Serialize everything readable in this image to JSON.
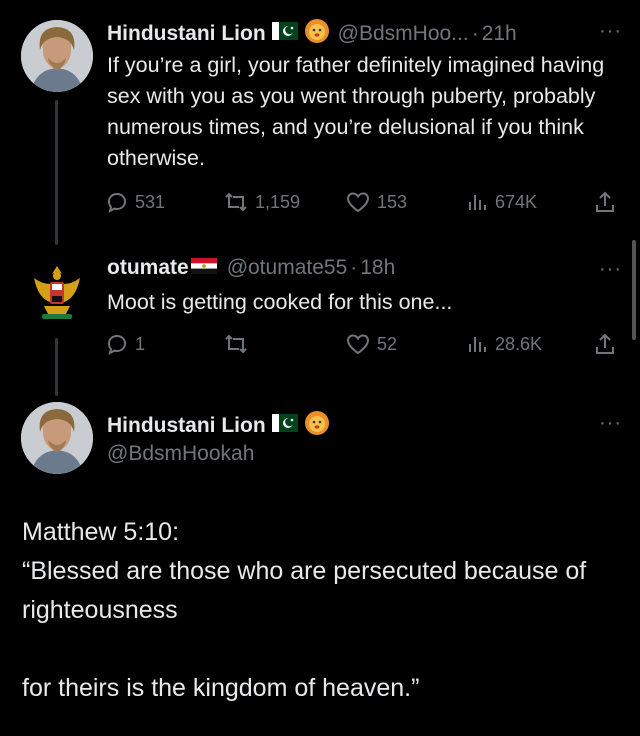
{
  "tweets": [
    {
      "name": "Hindustani Lion",
      "handle": "@BdsmHoo...",
      "time": "21h",
      "text": "If you’re a girl, your father definitely imagined having sex with you as you went through puberty, probably numerous times, and you’re delusional if you think otherwise.",
      "replies": "531",
      "reposts": "1,159",
      "likes": "153",
      "views": "674K"
    },
    {
      "name": "otumate",
      "handle": "@otumate55",
      "time": "18h",
      "text": "Moot is getting cooked for this one...",
      "replies": "1",
      "reposts": "",
      "likes": "52",
      "views": "28.6K"
    }
  ],
  "main_tweet": {
    "name": "Hindustani Lion",
    "handle": "@BdsmHookah",
    "text": "Matthew 5:10:\n“Blessed are those who are persecuted because of righteousness\n\nfor theirs is the kingdom of heaven.”"
  },
  "separator": "·",
  "more_label": "···",
  "icons": [
    "reply-icon",
    "repost-icon",
    "like-icon",
    "views-icon",
    "share-icon",
    "pakistan-flag-icon",
    "lion-emoji-icon",
    "egypt-flag-icon",
    "eagle-emblem-icon"
  ],
  "colors": {
    "background": "#000000",
    "text": "#e7e9ea",
    "muted": "#71767b",
    "thread_line": "#333639"
  }
}
